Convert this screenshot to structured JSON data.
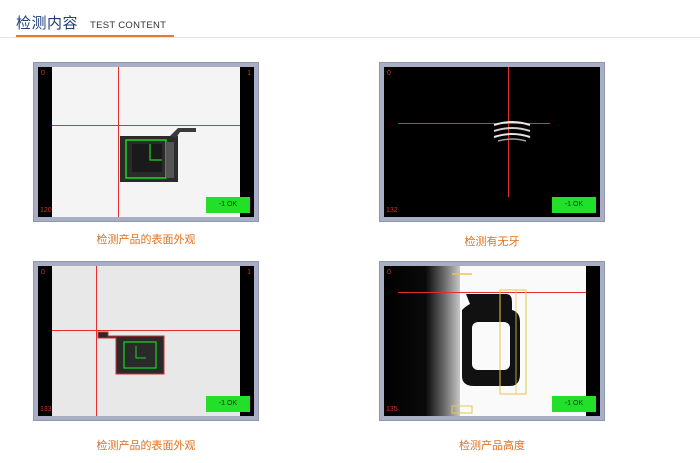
{
  "header": {
    "title": "检测内容",
    "subtitle": "TEST CONTENT"
  },
  "colors": {
    "accent": "#e57a2f",
    "title": "#1d3d7a",
    "caption": "#e0701e",
    "ok_green": "#22e02a",
    "crosshair": "#e23030"
  },
  "panels": [
    {
      "caption": "检测产品的表面外观",
      "corner_tl": "0",
      "corner_tr": "1",
      "corner_bl": "120",
      "status": "-1 OK"
    },
    {
      "caption": "检测有无牙",
      "corner_tl": "0",
      "corner_bl": "132",
      "status": "-1 OK"
    },
    {
      "caption": "检测产品的表面外观",
      "corner_tl": "0",
      "corner_tr": "1",
      "corner_bl": "133",
      "status": "-1 OK"
    },
    {
      "caption": "检测产品高度",
      "corner_tl": "0",
      "corner_bl": "135",
      "status": "-1 OK"
    }
  ]
}
